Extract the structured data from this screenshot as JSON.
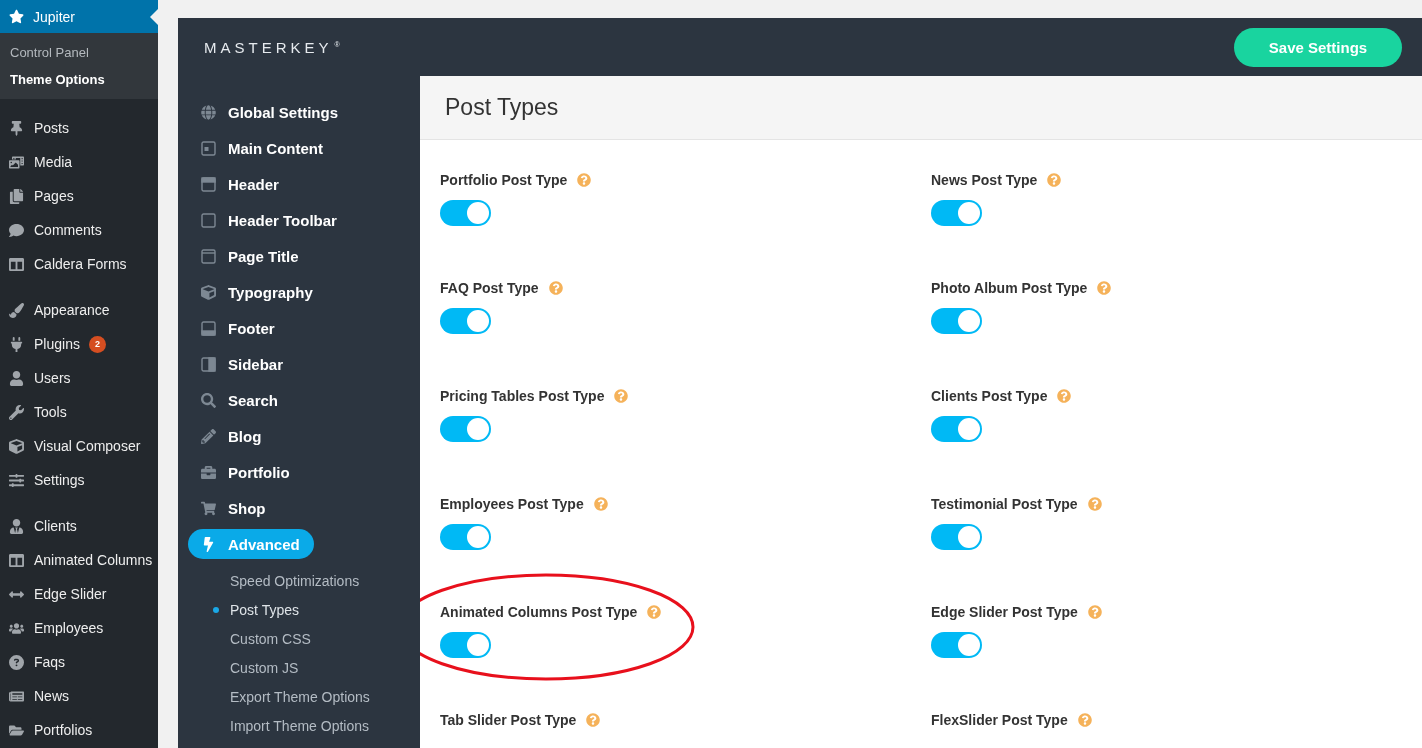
{
  "wp_menu": {
    "header": {
      "label": "Jupiter",
      "selected": true
    },
    "submenu": [
      {
        "label": "Control Panel",
        "selected": false
      },
      {
        "label": "Theme Options",
        "selected": true
      }
    ],
    "groups": [
      [
        {
          "label": "Posts"
        },
        {
          "label": "Media"
        },
        {
          "label": "Pages"
        },
        {
          "label": "Comments"
        },
        {
          "label": "Caldera Forms"
        }
      ],
      [
        {
          "label": "Appearance"
        },
        {
          "label": "Plugins",
          "badge": "2"
        },
        {
          "label": "Users"
        },
        {
          "label": "Tools"
        },
        {
          "label": "Visual Composer"
        },
        {
          "label": "Settings"
        }
      ],
      [
        {
          "label": "Clients"
        },
        {
          "label": "Animated Columns"
        },
        {
          "label": "Edge Slider"
        },
        {
          "label": "Employees"
        },
        {
          "label": "Faqs"
        },
        {
          "label": "News"
        },
        {
          "label": "Portfolios"
        }
      ]
    ]
  },
  "header": {
    "logo": "MASTERKEY",
    "logo_mark": "®",
    "save_button": "Save Settings"
  },
  "theme_nav": [
    {
      "label": "Global Settings",
      "selected": false
    },
    {
      "label": "Main Content",
      "selected": false
    },
    {
      "label": "Header",
      "selected": false
    },
    {
      "label": "Header Toolbar",
      "selected": false
    },
    {
      "label": "Page Title",
      "selected": false
    },
    {
      "label": "Typography",
      "selected": false
    },
    {
      "label": "Footer",
      "selected": false
    },
    {
      "label": "Sidebar",
      "selected": false
    },
    {
      "label": "Search",
      "selected": false
    },
    {
      "label": "Blog",
      "selected": false
    },
    {
      "label": "Portfolio",
      "selected": false
    },
    {
      "label": "Shop",
      "selected": false
    },
    {
      "label": "Advanced",
      "selected": true,
      "children": [
        {
          "label": "Speed Optimizations",
          "selected": false
        },
        {
          "label": "Post Types",
          "selected": true
        },
        {
          "label": "Custom CSS",
          "selected": false
        },
        {
          "label": "Custom JS",
          "selected": false
        },
        {
          "label": "Export Theme Options",
          "selected": false
        },
        {
          "label": "Import Theme Options",
          "selected": false
        }
      ]
    }
  ],
  "page_title": "Post Types",
  "options": [
    {
      "label": "Portfolio Post Type",
      "on": true
    },
    {
      "label": "News Post Type",
      "on": true
    },
    {
      "label": "FAQ Post Type",
      "on": true
    },
    {
      "label": "Photo Album Post Type",
      "on": true
    },
    {
      "label": "Pricing Tables Post Type",
      "on": true
    },
    {
      "label": "Clients Post Type",
      "on": true
    },
    {
      "label": "Employees Post Type",
      "on": true
    },
    {
      "label": "Testimonial Post Type",
      "on": true
    },
    {
      "label": "Animated Columns Post Type",
      "on": true,
      "highlighted": true
    },
    {
      "label": "Edge Slider Post Type",
      "on": true
    },
    {
      "label": "Tab Slider Post Type"
    },
    {
      "label": "FlexSlider Post Type"
    }
  ]
}
